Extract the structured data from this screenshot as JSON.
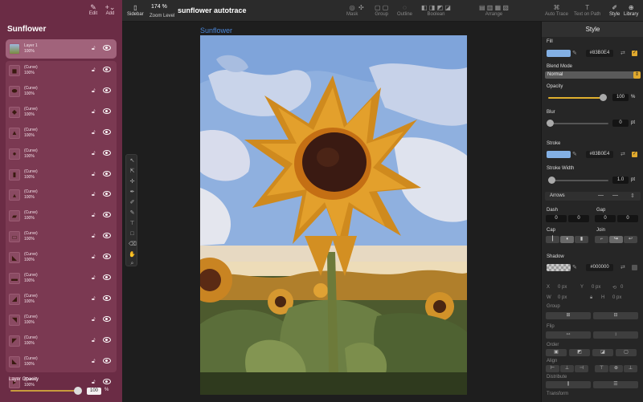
{
  "sidebar": {
    "edit_label": "Edit",
    "add_label": "Add",
    "title": "Sunflower",
    "layers": [
      {
        "name": "Layer 1",
        "opacity": "100%"
      },
      {
        "name": "(Curve)",
        "opacity": "100%"
      },
      {
        "name": "(Curve)",
        "opacity": "100%"
      },
      {
        "name": "(Curve)",
        "opacity": "100%"
      },
      {
        "name": "(Curve)",
        "opacity": "100%"
      },
      {
        "name": "(Curve)",
        "opacity": "100%"
      },
      {
        "name": "(Curve)",
        "opacity": "100%"
      },
      {
        "name": "(Curve)",
        "opacity": "100%"
      },
      {
        "name": "(Curve)",
        "opacity": "100%"
      },
      {
        "name": "(Curve)",
        "opacity": "100%"
      },
      {
        "name": "(Curve)",
        "opacity": "100%"
      },
      {
        "name": "(Curve)",
        "opacity": "100%"
      },
      {
        "name": "(Curve)",
        "opacity": "100%"
      },
      {
        "name": "(Curve)",
        "opacity": "100%"
      },
      {
        "name": "(Curve)",
        "opacity": "100%"
      },
      {
        "name": "(Curve)",
        "opacity": "100%"
      },
      {
        "name": "(Curve)",
        "opacity": "100%"
      }
    ],
    "layer_opacity_label": "Layer Opacity",
    "layer_opacity_value": "100",
    "layer_opacity_unit": "%"
  },
  "toolbar": {
    "sidebar_label": "Sidebar",
    "zoom_value": "174 %",
    "zoom_label": "Zoom Level",
    "document_title": "sunflower autotrace",
    "mask_label": "Mask",
    "group_label": "Group",
    "outline_label": "Outline",
    "boolean_label": "Boolean",
    "arrange_label": "Arrange",
    "auto_trace_label": "Auto Trace",
    "text_on_path_label": "Text on Path",
    "style_label": "Style",
    "library_label": "Library"
  },
  "canvas": {
    "artboard_name": "Sunflower"
  },
  "inspector": {
    "header": "Style",
    "fill_label": "Fill",
    "fill_hex": "#83B0E4",
    "fill_color": "#83B0E4",
    "blend_mode_label": "Blend Mode",
    "blend_mode_value": "Normal",
    "opacity_label": "Opacity",
    "opacity_value": "100",
    "opacity_unit": "%",
    "blur_label": "Blur",
    "blur_value": "0",
    "blur_unit": "pt",
    "stroke_label": "Stroke",
    "stroke_hex": "#83B0E4",
    "stroke_width_label": "Stroke Width",
    "stroke_width_value": "1.0",
    "stroke_width_unit": "pt",
    "arrows_label": "Arrows",
    "dash_label": "Dash",
    "gap_label": "Gap",
    "dash_values": [
      "0",
      "0"
    ],
    "gap_values": [
      "0",
      "0"
    ],
    "cap_label": "Cap",
    "join_label": "Join",
    "shadow_label": "Shadow",
    "shadow_hex": "#000000",
    "x_label": "X",
    "x_value": "0 px",
    "y_label": "Y",
    "y_value": "0 px",
    "w_label": "W",
    "w_value": "0 px",
    "h_label": "H",
    "h_value": "0 px",
    "rotation_value": "0",
    "group_label": "Group",
    "flip_label": "Flip",
    "order_label": "Order",
    "align_label": "Align",
    "distribute_label": "Distribute",
    "transform_label": "Transform"
  },
  "colors": {
    "sidebar_bg": "#6b2c45",
    "accent_gold": "#e0b02e",
    "artboard_label_blue": "#4a86d8"
  }
}
